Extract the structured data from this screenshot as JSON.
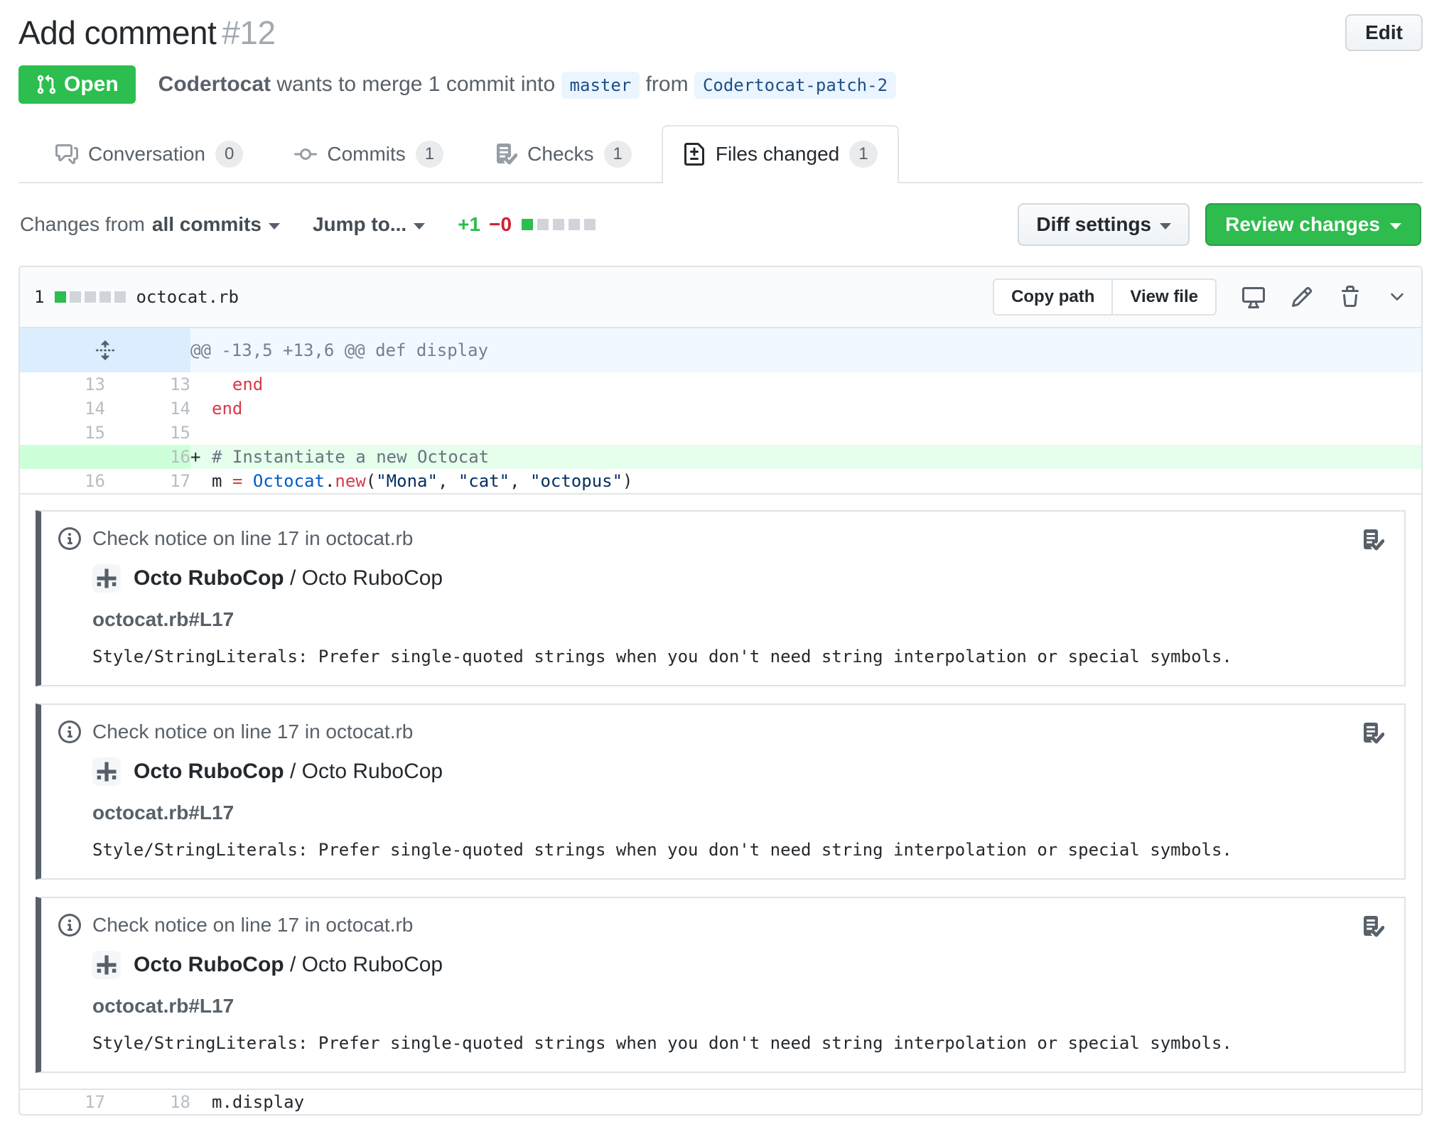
{
  "colors": {
    "open_green": "#2cbe4e",
    "primary_button_green": "#2ebc4e",
    "addition_green": "#2cbe4e",
    "deletion_red": "#cb2431",
    "added_line_bg": "#e6ffed",
    "added_gutter_bg": "#cdffd8",
    "hunk_bg": "#f1f8ff",
    "hunk_gutter_bg": "#dbedff",
    "branch_label_bg": "#eaf5ff",
    "annotation_accent": "#57606a"
  },
  "header": {
    "title": "Add comment",
    "number": "#12",
    "edit_label": "Edit"
  },
  "meta": {
    "state_label": "Open",
    "author": "Codertocat",
    "action_text": "wants to merge 1 commit into",
    "base_branch": "master",
    "from_word": "from",
    "head_branch": "Codertocat-patch-2"
  },
  "tabs": [
    {
      "label": "Conversation",
      "count": "0",
      "active": false
    },
    {
      "label": "Commits",
      "count": "1",
      "active": false
    },
    {
      "label": "Checks",
      "count": "1",
      "active": false
    },
    {
      "label": "Files changed",
      "count": "1",
      "active": true
    }
  ],
  "toolbar": {
    "changes_from_label": "Changes from",
    "changes_from_value": "all commits",
    "jump_to_label": "Jump to...",
    "additions": "+1",
    "deletions": "−0",
    "diffstat": {
      "added_blocks": 1,
      "neutral_blocks": 4
    },
    "diff_settings_label": "Diff settings",
    "review_changes_label": "Review changes"
  },
  "file": {
    "changed_files_count": "1",
    "name": "octocat.rb",
    "copy_path_label": "Copy path",
    "view_file_label": "View file",
    "diffstat": {
      "added_blocks": 1,
      "neutral_blocks": 4
    }
  },
  "diff": {
    "hunk_header": "@@ -13,5 +13,6 @@ def display",
    "rows": [
      {
        "old": "13",
        "new": "13",
        "prefix": "",
        "segments": [
          {
            "text": "  end",
            "type": "keyword"
          }
        ]
      },
      {
        "old": "14",
        "new": "14",
        "prefix": "",
        "segments": [
          {
            "text": "end",
            "type": "keyword"
          }
        ]
      },
      {
        "old": "15",
        "new": "15",
        "prefix": "",
        "segments": []
      },
      {
        "old": "",
        "new": "16",
        "prefix": "+",
        "added": true,
        "segments": [
          {
            "text": "# Instantiate a new Octocat",
            "type": "comment"
          }
        ]
      },
      {
        "old": "16",
        "new": "17",
        "prefix": "",
        "segments": [
          {
            "text": "m ",
            "type": "plain"
          },
          {
            "text": "=",
            "type": "keyword"
          },
          {
            "text": " ",
            "type": "plain"
          },
          {
            "text": "Octocat",
            "type": "constant"
          },
          {
            "text": ".",
            "type": "plain"
          },
          {
            "text": "new",
            "type": "keyword"
          },
          {
            "text": "(",
            "type": "plain"
          },
          {
            "text": "\"Mona\"",
            "type": "string"
          },
          {
            "text": ", ",
            "type": "plain"
          },
          {
            "text": "\"cat\"",
            "type": "string"
          },
          {
            "text": ", ",
            "type": "plain"
          },
          {
            "text": "\"octopus\"",
            "type": "string"
          },
          {
            "text": ")",
            "type": "plain"
          }
        ]
      }
    ],
    "tail_row": {
      "old": "17",
      "new": "18",
      "prefix": "",
      "segments": [
        {
          "text": "m.display",
          "type": "plain"
        }
      ]
    }
  },
  "annotations": [
    {
      "title": "Check notice on line 17 in octocat.rb",
      "app_name": "Octo RuboCop",
      "separator": " / ",
      "app_context": "Octo RuboCop",
      "path": "octocat.rb#L17",
      "message": "Style/StringLiterals: Prefer single-quoted strings when you don't need string interpolation or special symbols."
    },
    {
      "title": "Check notice on line 17 in octocat.rb",
      "app_name": "Octo RuboCop",
      "separator": " / ",
      "app_context": "Octo RuboCop",
      "path": "octocat.rb#L17",
      "message": "Style/StringLiterals: Prefer single-quoted strings when you don't need string interpolation or special symbols."
    },
    {
      "title": "Check notice on line 17 in octocat.rb",
      "app_name": "Octo RuboCop",
      "separator": " / ",
      "app_context": "Octo RuboCop",
      "path": "octocat.rb#L17",
      "message": "Style/StringLiterals: Prefer single-quoted strings when you don't need string interpolation or special symbols."
    }
  ]
}
